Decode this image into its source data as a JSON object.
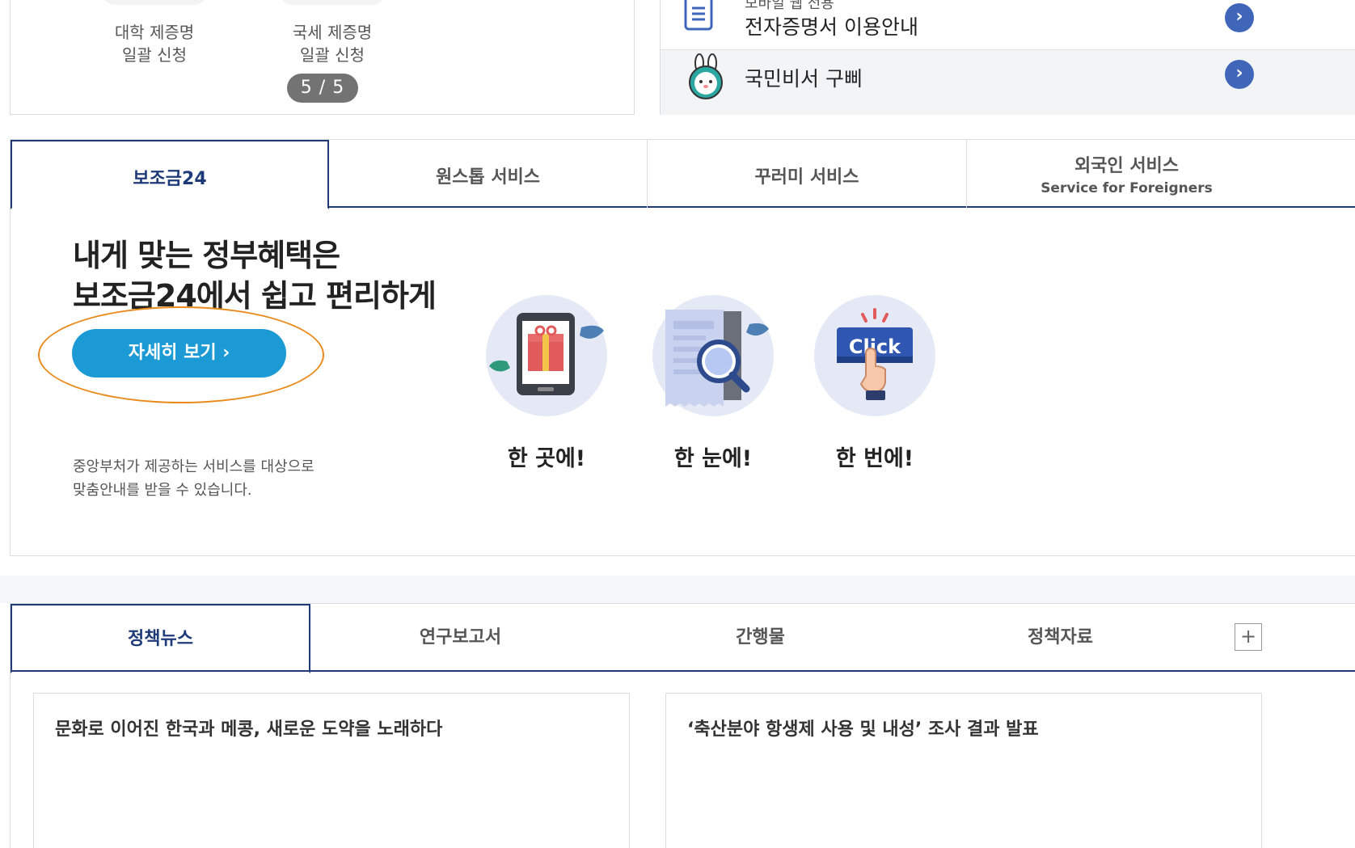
{
  "certificates": {
    "items": [
      {
        "label": "대학 제증명\n일괄 신청"
      },
      {
        "label": "국세 제증명\n일괄 신청"
      }
    ],
    "pager": "5 / 5"
  },
  "quick_links": {
    "row1_small": "모바일 웹 전용",
    "row1_text": "전자증명서 이용안내",
    "row2_text": "국민비서 구삐",
    "chevron": "›"
  },
  "service_tabs": {
    "tabs": [
      {
        "label": "보조금24",
        "sub": ""
      },
      {
        "label": "원스톱 서비스",
        "sub": ""
      },
      {
        "label": "꾸러미 서비스",
        "sub": ""
      },
      {
        "label": "외국인 서비스",
        "sub": "Service for Foreigners"
      }
    ],
    "headline": "내게 맞는 정부혜택은\n보조금24에서 쉽고 편리하게",
    "detail_button": "자세히 보기 ›",
    "description": "중앙부처가 제공하는 서비스를 대상으로\n맞춤안내를 받을 수 있습니다.",
    "features": [
      {
        "caption": "한 곳에!",
        "icon": "tablet-gift-icon"
      },
      {
        "caption": "한 눈에!",
        "icon": "receipt-magnifier-icon"
      },
      {
        "caption": "한 번에!",
        "icon": "click-button-icon",
        "icon_text": "Click"
      }
    ]
  },
  "news": {
    "tabs": [
      {
        "label": "정책뉴스"
      },
      {
        "label": "연구보고서"
      },
      {
        "label": "간행물"
      },
      {
        "label": "정책자료"
      }
    ],
    "more": "+",
    "cards": [
      {
        "title": "문화로 이어진 한국과 메콩, 새로운 도약을 노래하다"
      },
      {
        "title": "‘축산분야 항생제 사용 및 내성’ 조사 결과 발표"
      }
    ]
  },
  "colors": {
    "navy": "#1e3a79",
    "button_blue": "#1b9ad6",
    "highlight_orange": "#e98a1c",
    "chevron_blue": "#3f66b9"
  }
}
